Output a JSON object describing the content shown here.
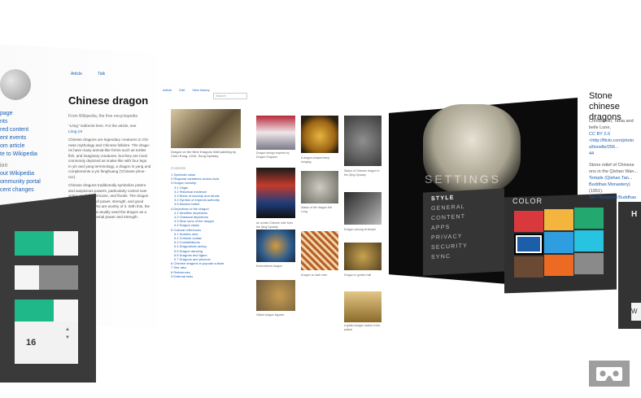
{
  "wiki": {
    "tabs": [
      "Article",
      "Talk"
    ],
    "title": "Chinese dragon",
    "subtitle": "From Wikipedia, the free encyclopedia",
    "side_links": [
      "page",
      "nts",
      "red content",
      "ent events",
      "om article",
      "te to Wikipedia",
      "ion",
      "out Wikipedia",
      "ommunity portal",
      "cent changes"
    ],
    "body_lines": [
      "\"Lóng\" redirects here. For the article, see",
      "Lóng (Al",
      "Chinese dragons are legendary creatures in Chi-",
      "nese mythology and Chinese folklore. The drago-",
      "ns have many animal-like forms such as turtles",
      "fish, and imaginary creatures, but they are most",
      "commonly depicted as snake-like with four legs.",
      "In yin and yang terminology, a dragon is yang and",
      "complements a yin fenghuang ('Chinese phoe-",
      "nix').",
      "Chinese dragons traditionally symbolize potent",
      "and auspicious powers, particularly control over",
      "water, rainfall, hurricane, and floods. The dragon",
      "is also a symbol of power, strength, and good",
      "luck for people who are worthy of it. With this, the",
      "Emperor of China usually used the dragon as a",
      "symbol of his imperial power and strength."
    ]
  },
  "mid": {
    "tabs": [
      "Article",
      "Edit",
      "View history"
    ],
    "search_placeholder": "Search",
    "caption": "Dragon on the Nine Dragons Wall painting by Chen Rong, 1244, Song Dynasty",
    "contents_title": "Contents",
    "contents": [
      "1 Symbolic value",
      "2 Regional variations across Asia",
      "3 Dragon worship",
      "3.1 Origin",
      "3.2 Historical evidence",
      "3.3 Mode of worship and rituals",
      "3.4 Symbol of imperial authority",
      "3.5 Modern belief",
      "4 Depictions of the dragon",
      "4.1 Neolithic depictions",
      "4.2 Classical depictions",
      "4.3 Nine sons of the dragon",
      "4.4 Dragon claws",
      "5 Cultural references",
      "5.1 Number nine",
      "5.2 Chinese zodiac",
      "5.3 Constellations",
      "5.4 Dragonboat racing",
      "5.5 Dragon dancing",
      "5.6 Dragons and tigers",
      "5.7 Dragons and phoenix",
      "6 Chinese dragons in popular culture",
      "7 See also",
      "8 References",
      "9 External links"
    ]
  },
  "gallery": {
    "captions": [
      "Dragon design inspired by Dragon Kingdom",
      "A dragon-shaped lamp hanging",
      "Statue of Chinese dragon in the Qing Dynasty",
      "An ornate Chinese robe from the Qing Dynasty",
      "Statue of the dragon Hai Long",
      "Dragon carving at temple",
      "Embroidered dragon",
      "Dragon on dark robe",
      "Dragon in golden hall",
      "Gilded dragon figurine",
      "A gilded dragon statue in the palace"
    ]
  },
  "settings": {
    "watermark": "SETTINGS",
    "items": [
      "STYLE",
      "GENERAL",
      "CONTENT",
      "APPS",
      "PRIVACY",
      "SECURITY",
      "SYNC"
    ],
    "active_item": "STYLE"
  },
  "color_panel": {
    "title": "COLOR",
    "selected_index": 3,
    "swatches": [
      "#d9383d",
      "#f3b53e",
      "#23a86f",
      "#1c5fa8",
      "#2f9ee0",
      "#28c3e0",
      "#6b4a34",
      "#ec6a22",
      "#8a8a8a"
    ]
  },
  "right_panel": {
    "heading": "H",
    "partial_letter": "W"
  },
  "right_article": {
    "title": "Stone chinese dragons",
    "lines": [
      "Christophel, Tania and",
      "belle Lune,",
      "CC BY 2.0",
      "<http://flickr.com/photo",
      "s/lionelle/256...",
      "44",
      "Stone relief of Chinese",
      "ons in the Qishan Wan...",
      "Temple (Qishan Tan...",
      "Buddhas Monastery)",
      "(1951).",
      "Tan Thousand Buddhas"
    ]
  },
  "toggles": {
    "items": [
      {
        "on": true,
        "accent": "#1fb889"
      },
      {
        "on": false,
        "accent": "#888888"
      },
      {
        "on": true,
        "accent": "#1fb889"
      }
    ],
    "stepper_value": "16"
  },
  "vr_button": {
    "icon": "cardboard-vr-icon"
  }
}
